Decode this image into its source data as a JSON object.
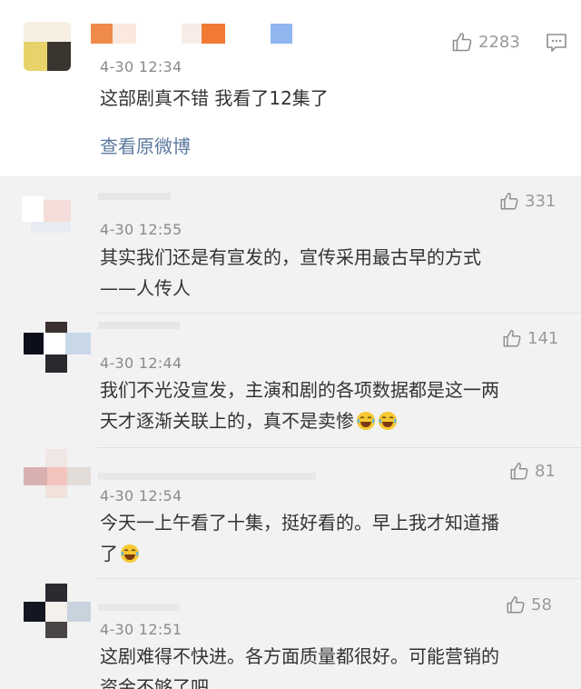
{
  "main_comment": {
    "timestamp": "4-30 12:34",
    "text": "这部剧真不错 我看了12集了",
    "view_original_link": "查看原微博",
    "likes": "2283",
    "like_icon": "thumbs-up-icon",
    "comment_icon": "comment-icon"
  },
  "replies": [
    {
      "timestamp": "4-30 12:55",
      "likes": "331",
      "lines": [
        "其实我们还是有宣发的，宣传采用最古早的方式",
        "——人传人"
      ]
    },
    {
      "timestamp": "4-30 12:44",
      "likes": "141",
      "lines": [
        "我们不光没宣发，主演和剧的各项数据都是这一两",
        "天才逐渐关联上的，真不是卖惨"
      ],
      "emojis": [
        "laugh-cry-emoji",
        "laugh-cry-emoji"
      ]
    },
    {
      "timestamp": "4-30 12:54",
      "likes": "81",
      "lines": [
        "今天一上午看了十集，挺好看的。早上我才知道播",
        "了"
      ],
      "emojis": [
        "laugh-cry-emoji"
      ]
    },
    {
      "timestamp": "4-30 12:51",
      "likes": "58",
      "lines": [
        "这剧难得不快进。各方面质量都很好。可能营销的",
        "资金不够了吧"
      ]
    }
  ],
  "colors": {
    "reply_background": "#f2f2f2",
    "link": "#5d7aa0",
    "timestamp": "#8a8a8a",
    "body_text": "#333333"
  }
}
